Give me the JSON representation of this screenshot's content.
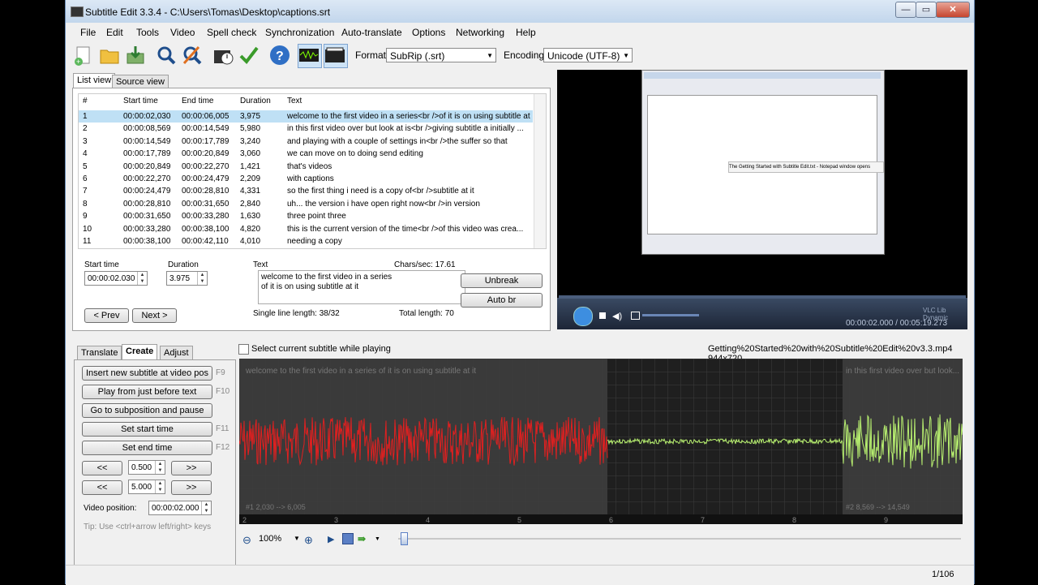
{
  "window": {
    "title": "Subtitle Edit 3.3.4 - C:\\Users\\Tomas\\Desktop\\captions.srt",
    "min": "—",
    "max": "▭",
    "close": "✕"
  },
  "menu": [
    "File",
    "Edit",
    "Tools",
    "Video",
    "Spell check",
    "Synchronization",
    "Auto-translate",
    "Options",
    "Networking",
    "Help"
  ],
  "toolbar": {
    "icons": [
      "new-file-icon",
      "open-folder-icon",
      "save-icon",
      "find-icon",
      "replace-icon",
      "visual-sync-icon",
      "spell-check-icon",
      "help-icon",
      "waveform-toggle-icon",
      "video-toggle-icon"
    ],
    "format_label": "Format",
    "format_value": "SubRip (.srt)",
    "encoding_label": "Encoding",
    "encoding_value": "Unicode (UTF-8)"
  },
  "tabs_top": {
    "list_view": "List view",
    "source_view": "Source view"
  },
  "grid": {
    "headers": [
      "#",
      "Start time",
      "End time",
      "Duration",
      "Text"
    ],
    "rows": [
      [
        "1",
        "00:00:02,030",
        "00:00:06,005",
        "3,975",
        "welcome to the first video in a series<br />of it is on using subtitle at i"
      ],
      [
        "2",
        "00:00:08,569",
        "00:00:14,549",
        "5,980",
        "in this first video over but look at is<br />giving subtitle a initially ..."
      ],
      [
        "3",
        "00:00:14,549",
        "00:00:17,789",
        "3,240",
        "and playing with a couple of settings in<br />the suffer so that"
      ],
      [
        "4",
        "00:00:17,789",
        "00:00:20,849",
        "3,060",
        "we can move on to doing send editing"
      ],
      [
        "5",
        "00:00:20,849",
        "00:00:22,270",
        "1,421",
        "that's videos"
      ],
      [
        "6",
        "00:00:22,270",
        "00:00:24,479",
        "2,209",
        "with captions"
      ],
      [
        "7",
        "00:00:24,479",
        "00:00:28,810",
        "4,331",
        "so the first thing i need is a copy of<br />subtitle at it"
      ],
      [
        "8",
        "00:00:28,810",
        "00:00:31,650",
        "2,840",
        "uh... the version i have open right now<br />in version"
      ],
      [
        "9",
        "00:00:31,650",
        "00:00:33,280",
        "1,630",
        "three point three"
      ],
      [
        "10",
        "00:00:33,280",
        "00:00:38,100",
        "4,820",
        "this is the current version of the time<br />of this video was crea..."
      ],
      [
        "11",
        "00:00:38,100",
        "00:00:42,110",
        "4,010",
        "needing a copy"
      ]
    ]
  },
  "edit": {
    "start_time_label": "Start time",
    "start_time": "00:00:02.030",
    "duration_label": "Duration",
    "duration": "3.975",
    "text_label": "Text",
    "chars_sec": "Chars/sec: 17.61",
    "text_line1": "welcome to the first video in a series",
    "text_line2": "of it is on using subtitle at it",
    "single_line_length": "Single line length: 38/32",
    "total_length": "Total length: 70",
    "unbreak": "Unbreak",
    "auto_br": "Auto br",
    "prev": "< Prev",
    "next": "Next >"
  },
  "video": {
    "overlay_text": "The Getting Started with Subtitle Edit.txt - Notepad window opens",
    "time": "00:00:02.000 / 00:05:19.273",
    "brand": "VLC Lib Dynamic"
  },
  "tabs_bottom": {
    "translate": "Translate",
    "create": "Create",
    "adjust": "Adjust"
  },
  "create": {
    "insert": "Insert new subtitle at video pos",
    "insert_key": "F9",
    "play_before": "Play from just before text",
    "play_before_key": "F10",
    "go_sub": "Go to subposition and pause",
    "set_start": "Set start time",
    "set_start_key": "F11",
    "set_end": "Set end time",
    "set_end_key": "F12",
    "back": "<<",
    "fwd": ">>",
    "step1": "0.500",
    "step2": "5.000",
    "video_pos_label": "Video position:",
    "video_pos": "00:00:02.000",
    "tip": "Tip: Use <ctrl+arrow left/right> keys"
  },
  "wave": {
    "select_label": "Select current subtitle while playing",
    "file_info": "Getting%20Started%20with%20Subtitle%20Edit%20v3.3.mp4 944x720",
    "sub1_text": "welcome to the first video in a series  of it is on using subtitle at it",
    "sub2_text": "in this first video over but look...",
    "sub1_info": "#1  2,030 --> 6,005",
    "sub2_info": "#2  8,569 --> 14,549",
    "seconds": [
      "2",
      "3",
      "4",
      "5",
      "6",
      "7",
      "8",
      "9"
    ],
    "zoom": "100%"
  },
  "status": {
    "position": "1/106"
  }
}
